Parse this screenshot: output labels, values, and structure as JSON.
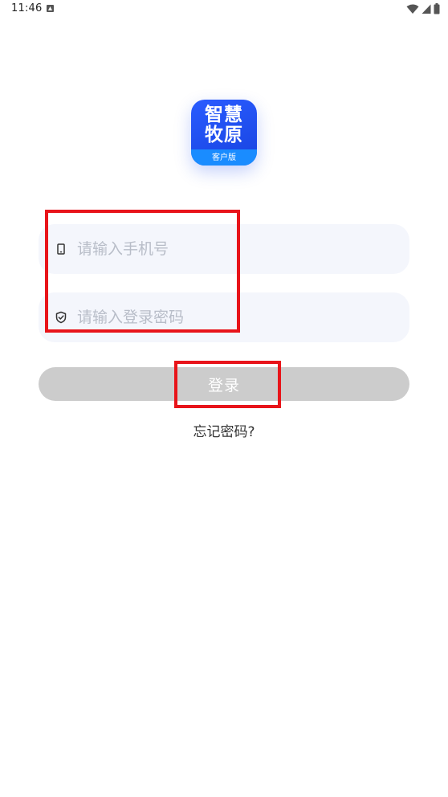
{
  "status_bar": {
    "time": "11:46",
    "notification_icon": "a-letter-notification-icon",
    "wifi_icon": "wifi-icon",
    "signal_icon": "cell-signal-icon",
    "battery_icon": "battery-icon"
  },
  "logo": {
    "line1": "智慧",
    "line2": "牧原",
    "subtitle": "客户版",
    "colors": {
      "primary": "#1743e0",
      "band": "#1a8cff"
    }
  },
  "phone_input": {
    "icon": "phone-icon",
    "placeholder": "请输入手机号",
    "value": ""
  },
  "password_input": {
    "icon": "shield-check-icon",
    "placeholder": "请输入登录密码",
    "value": ""
  },
  "login_button": {
    "label": "登录",
    "color": "#cccccc"
  },
  "forgot_password": {
    "label": "忘记密码?"
  },
  "annotation_color": "#e8141a"
}
